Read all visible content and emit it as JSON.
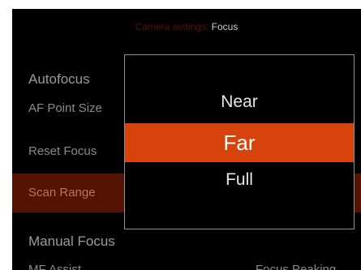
{
  "header": {
    "prefix": "Camera settings:",
    "page": "Focus"
  },
  "menu": {
    "autofocus_section": "Autofocus",
    "items": [
      "AF Point Size",
      "Reset Focus",
      "Scan Range"
    ],
    "selected_index": 2,
    "manual_section": "Manual Focus",
    "partial_next_label": "MF Assist",
    "partial_next_value": "Focus Peaking"
  },
  "popup": {
    "options": [
      "Near",
      "Far",
      "Full"
    ],
    "selected": "Far"
  },
  "colors": {
    "accent": "#d6440c",
    "selected_row_bg": "#541303",
    "background": "#000000"
  }
}
